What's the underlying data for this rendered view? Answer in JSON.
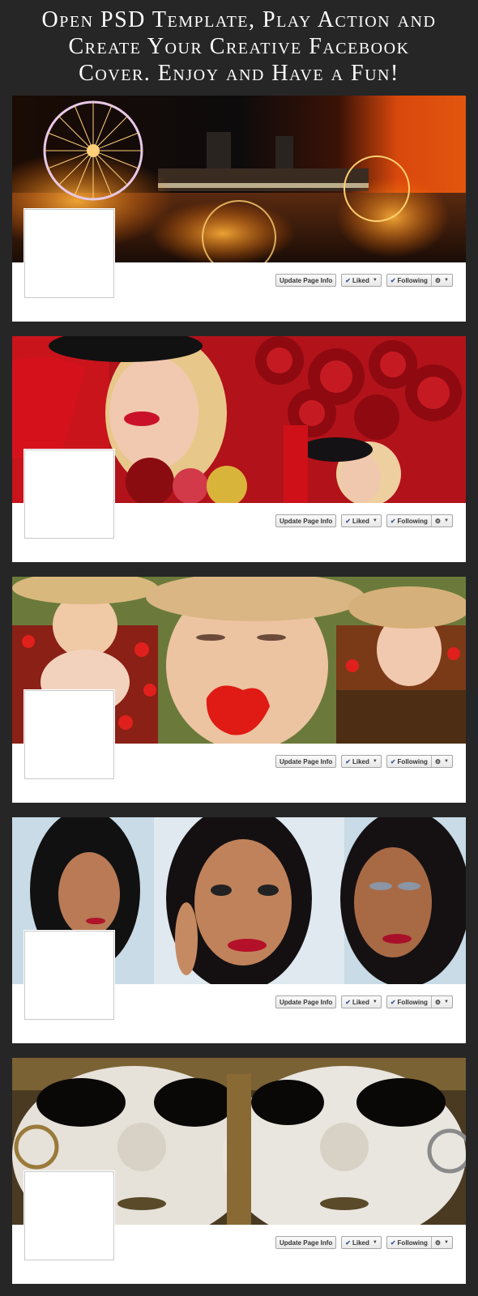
{
  "headline": {
    "line1": "Open PSD Template, Play Action and",
    "line2": "Create Your Creative Facebook",
    "line3": "Cover. Enjoy and Have a Fun!"
  },
  "buttons": {
    "update": "Update Page Info",
    "liked": "Liked",
    "following": "Following",
    "check_glyph": "✔",
    "caret_glyph": "▼",
    "gear_glyph": "⚙"
  },
  "covers": [
    {
      "theme": "city-night-ferris-wheel"
    },
    {
      "theme": "woman-red-roses"
    },
    {
      "theme": "girl-straw-hat-poppies"
    },
    {
      "theme": "woman-portraits"
    },
    {
      "theme": "venetian-masks"
    }
  ],
  "colors": {
    "background": "#262626",
    "panel": "#ffffff",
    "button_border": "#a6a6a6",
    "check": "#3b5998"
  }
}
